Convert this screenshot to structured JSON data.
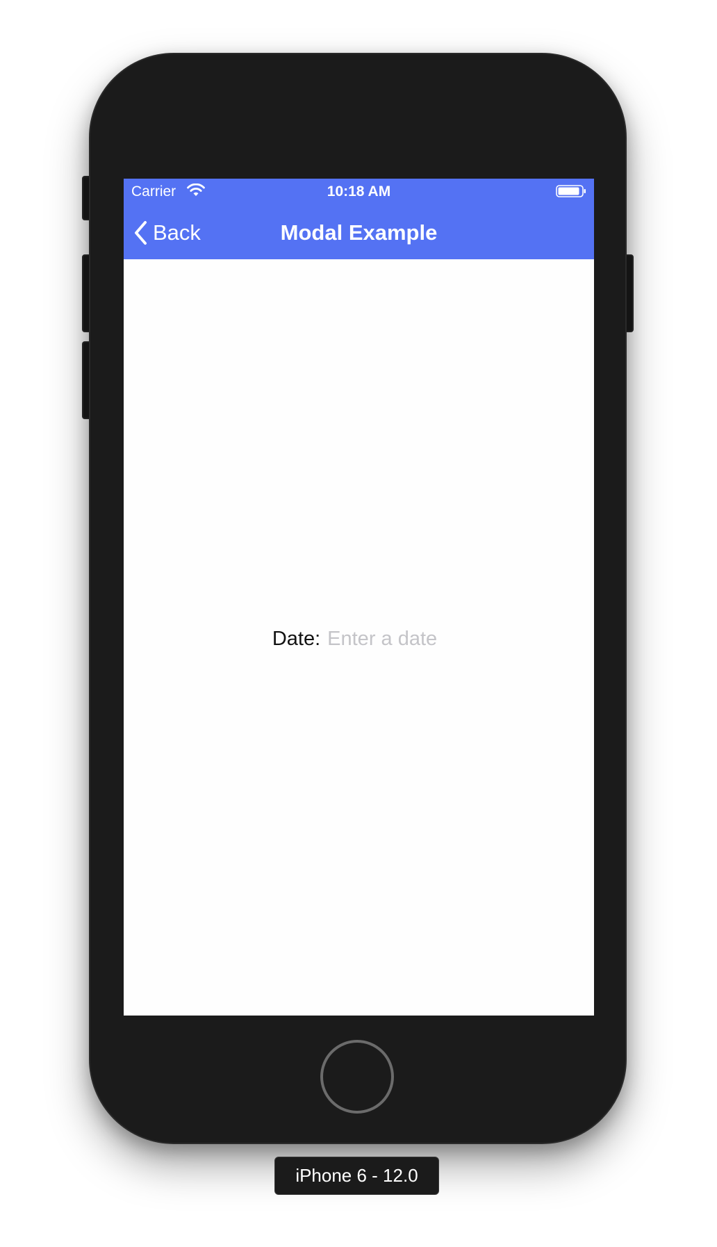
{
  "status_bar": {
    "carrier": "Carrier",
    "time": "10:18 AM"
  },
  "nav_bar": {
    "back_label": "Back",
    "title": "Modal Example",
    "background_color": "#5472f3"
  },
  "form": {
    "date_label": "Date:",
    "date_value": "",
    "date_placeholder": "Enter a date"
  },
  "device": {
    "caption": "iPhone 6 - 12.0"
  },
  "icons": {
    "wifi": "wifi-icon",
    "battery": "battery-icon",
    "back": "chevron-left-icon",
    "home": "home-button"
  }
}
